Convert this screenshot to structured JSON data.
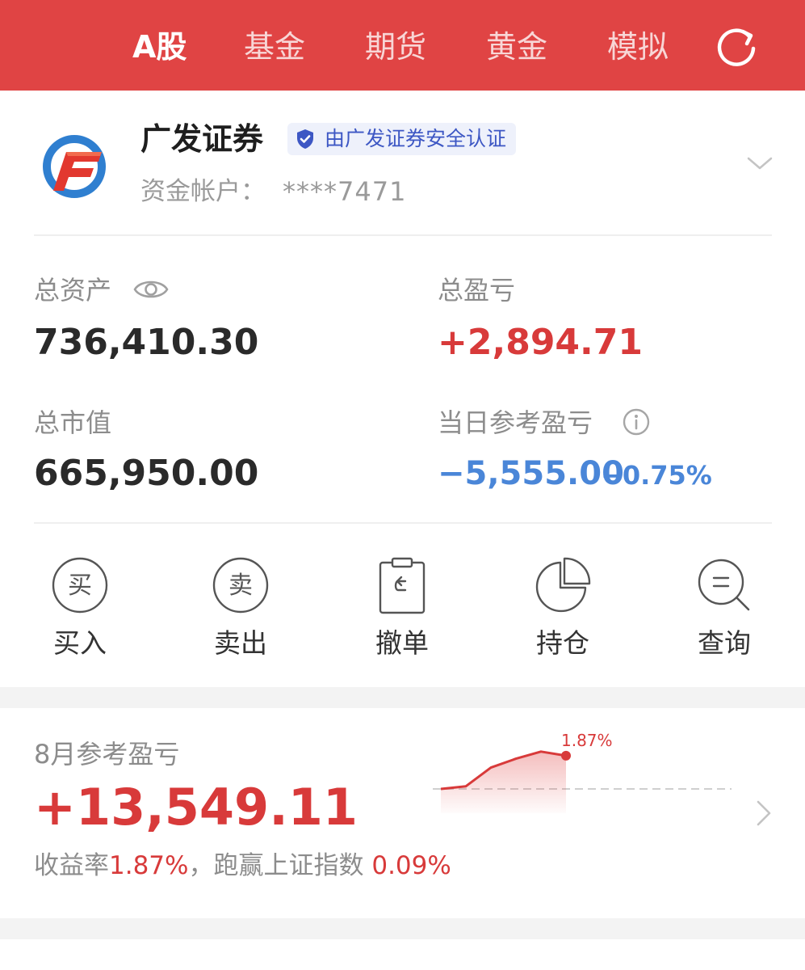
{
  "tabs": [
    {
      "label": "A股",
      "active": true
    },
    {
      "label": "基金",
      "active": false
    },
    {
      "label": "期货",
      "active": false
    },
    {
      "label": "黄金",
      "active": false
    },
    {
      "label": "模拟",
      "active": false
    }
  ],
  "colors": {
    "brand_red": "#e04444",
    "profit_red": "#d83a3a",
    "loss_blue": "#4a86d8",
    "cert_blue": "#3d57c4"
  },
  "icons": {
    "refresh": "refresh-icon",
    "logo": "broker-logo",
    "shield": "shield-check-icon",
    "eye": "eye-icon",
    "info": "info-icon",
    "chevron_down": "chevron-down-icon",
    "chevron_right": "chevron-right-icon"
  },
  "account": {
    "broker_name": "广发证券",
    "certification": "由广发证券安全认证",
    "account_label": "资金帐户：",
    "account_number": "****7471"
  },
  "summary": {
    "total_assets_label": "总资产",
    "total_assets_value": "736,410.30",
    "total_pnl_label": "总盈亏",
    "total_pnl_value": "+2,894.71",
    "market_value_label": "总市值",
    "market_value_value": "665,950.00",
    "daily_pnl_label": "当日参考盈亏",
    "daily_pnl_value": "−5,555.00",
    "daily_pnl_pct": "−0.75%"
  },
  "actions": [
    {
      "label": "买入",
      "icon": "buy-icon",
      "glyph": "买"
    },
    {
      "label": "卖出",
      "icon": "sell-icon",
      "glyph": "卖"
    },
    {
      "label": "撤单",
      "icon": "cancel-order-icon"
    },
    {
      "label": "持仓",
      "icon": "pie-chart-icon"
    },
    {
      "label": "查询",
      "icon": "search-icon"
    }
  ],
  "monthly": {
    "label": "8月参考盈亏",
    "value": "+13,549.11",
    "return_label": "收益率",
    "return_value": "1.87%",
    "separator": "，",
    "beat_label": "跑赢上证指数",
    "beat_value": "0.09%",
    "chart_last_label": "1.87%"
  },
  "chart_data": {
    "type": "area",
    "values": [
      0.0,
      0.15,
      1.2,
      1.7,
      2.1,
      1.87
    ],
    "last_label": "1.87%",
    "baseline": 0
  }
}
